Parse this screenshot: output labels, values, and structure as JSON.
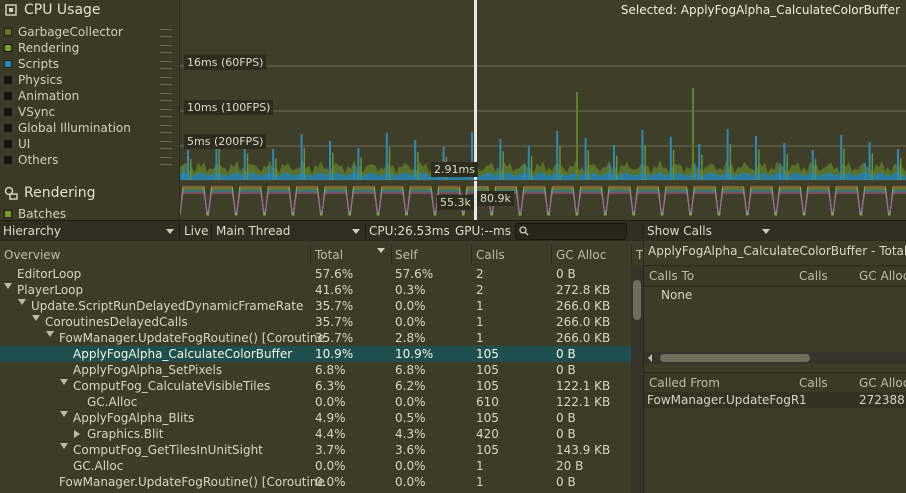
{
  "selected_label": "Selected: ApplyFogAlpha_CalculateColorBuffer",
  "cpu_module": {
    "title": "CPU Usage",
    "items": [
      {
        "label": "GarbageCollector",
        "color": "#7a6a1e"
      },
      {
        "label": "Rendering",
        "color": "#7aa01e"
      },
      {
        "label": "Scripts",
        "color": "#1e8ab4"
      },
      {
        "label": "Physics",
        "color": "#111111"
      },
      {
        "label": "Animation",
        "color": "#111111"
      },
      {
        "label": "VSync",
        "color": "#111111"
      },
      {
        "label": "Global Illumination",
        "color": "#111111"
      },
      {
        "label": "UI",
        "color": "#111111"
      },
      {
        "label": "Others",
        "color": "#111111"
      }
    ]
  },
  "rendering_module": {
    "title": "Rendering",
    "items": [
      {
        "label": "Batches",
        "color": "#7aa01e"
      }
    ]
  },
  "chart": {
    "gridlines": [
      "16ms (60FPS)",
      "10ms (100FPS)",
      "5ms (200FPS)"
    ],
    "cursor_value": "2.91ms",
    "render_values": [
      "55.3k",
      "80.9k"
    ]
  },
  "toolbar": {
    "view": "Hierarchy",
    "live": "Live",
    "thread": "Main Thread",
    "cpu": "CPU:26.53ms",
    "gpu": "GPU:--ms",
    "details": "Show Calls"
  },
  "tree": {
    "columns": [
      "Overview",
      "Total",
      "Self",
      "Calls",
      "GC Alloc",
      "T"
    ],
    "rows": [
      {
        "name": "EditorLoop",
        "total": "57.6%",
        "self": "57.6%",
        "calls": "2",
        "gc": "0 B"
      },
      {
        "name": "PlayerLoop",
        "total": "41.6%",
        "self": "0.3%",
        "calls": "2",
        "gc": "272.8 KB"
      },
      {
        "name": "Update.ScriptRunDelayedDynamicFrameRate",
        "total": "35.7%",
        "self": "0.0%",
        "calls": "1",
        "gc": "266.0 KB"
      },
      {
        "name": "CoroutinesDelayedCalls",
        "total": "35.7%",
        "self": "0.0%",
        "calls": "1",
        "gc": "266.0 KB"
      },
      {
        "name": "FowManager.UpdateFogRoutine() [Coroutine",
        "total": "35.7%",
        "self": "2.8%",
        "calls": "1",
        "gc": "266.0 KB"
      },
      {
        "name": "ApplyFogAlpha_CalculateColorBuffer",
        "total": "10.9%",
        "self": "10.9%",
        "calls": "105",
        "gc": "0 B"
      },
      {
        "name": "ApplyFogAlpha_SetPixels",
        "total": "6.8%",
        "self": "6.8%",
        "calls": "105",
        "gc": "0 B"
      },
      {
        "name": "ComputFog_CalculateVisibleTiles",
        "total": "6.3%",
        "self": "6.2%",
        "calls": "105",
        "gc": "122.1 KB"
      },
      {
        "name": "GC.Alloc",
        "total": "0.0%",
        "self": "0.0%",
        "calls": "610",
        "gc": "122.1 KB"
      },
      {
        "name": "ApplyFogAlpha_Blits",
        "total": "4.9%",
        "self": "0.5%",
        "calls": "105",
        "gc": "0 B"
      },
      {
        "name": "Graphics.Blit",
        "total": "4.4%",
        "self": "4.3%",
        "calls": "420",
        "gc": "0 B"
      },
      {
        "name": "ComputFog_GetTilesInUnitSight",
        "total": "3.7%",
        "self": "3.6%",
        "calls": "105",
        "gc": "143.9 KB"
      },
      {
        "name": "GC.Alloc",
        "total": "0.0%",
        "self": "0.0%",
        "calls": "1",
        "gc": "20 B"
      },
      {
        "name": "FowManager.UpdateFogRoutine() [Coroutine",
        "total": "0.0%",
        "self": "0.0%",
        "calls": "1",
        "gc": "0 B"
      }
    ]
  },
  "details": {
    "title": "ApplyFogAlpha_CalculateColorBuffer - Total ti",
    "calls_to": {
      "columns": [
        "Calls To",
        "Calls",
        "GC Alloc"
      ],
      "rows": [
        {
          "name": "None",
          "calls": "",
          "gc": ""
        }
      ]
    },
    "called_from": {
      "columns": [
        "Called From",
        "Calls",
        "GC Alloc"
      ],
      "rows": [
        {
          "name": "FowManager.UpdateFogR",
          "calls": "1",
          "gc": "272388"
        }
      ]
    }
  }
}
